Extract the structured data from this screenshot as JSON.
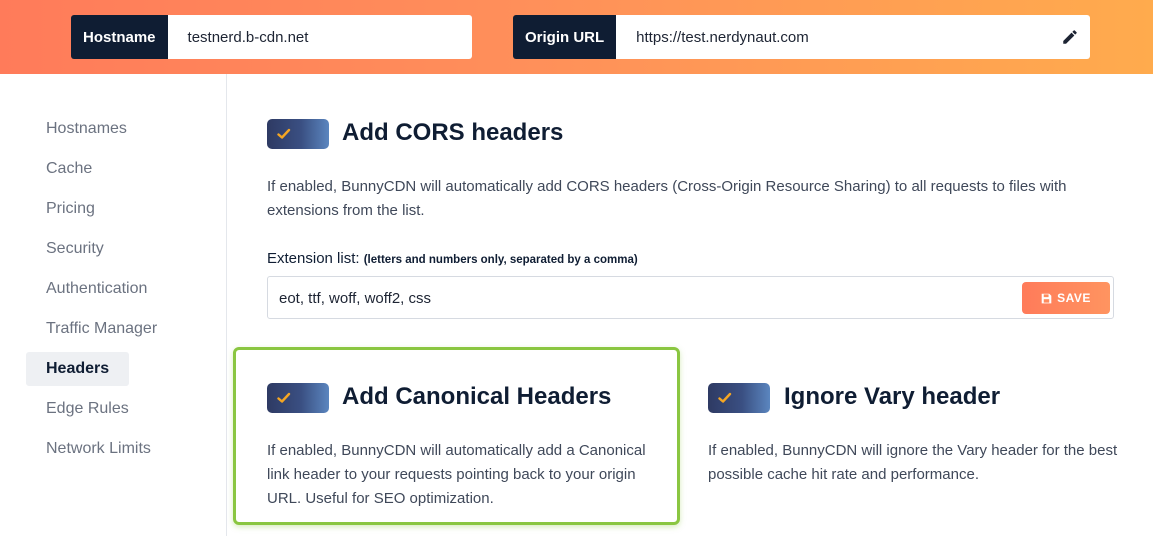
{
  "topbar": {
    "hostname_label": "Hostname",
    "hostname_value": "testnerd.b-cdn.net",
    "origin_label": "Origin URL",
    "origin_value": "https://test.nerdynaut.com",
    "edit_icon": "pencil-icon"
  },
  "sidebar": {
    "items": [
      {
        "label": "Hostnames"
      },
      {
        "label": "Cache"
      },
      {
        "label": "Pricing"
      },
      {
        "label": "Security"
      },
      {
        "label": "Authentication"
      },
      {
        "label": "Traffic Manager"
      },
      {
        "label": "Headers",
        "active": true
      },
      {
        "label": "Edge Rules"
      },
      {
        "label": "Network Limits"
      }
    ]
  },
  "cors": {
    "title": "Add CORS headers",
    "enabled": true,
    "description": "If enabled, BunnyCDN will automatically add CORS headers (Cross-Origin Resource Sharing) to all requests to files with extensions from the list.",
    "extension_label": "Extension list:",
    "extension_hint": "(letters and numbers only, separated by a comma)",
    "extension_value": "eot, ttf, woff, woff2, css",
    "save_label": "SAVE",
    "save_icon": "floppy-disk-icon"
  },
  "canonical": {
    "title": "Add Canonical Headers",
    "enabled": true,
    "description": "If enabled, BunnyCDN will automatically add a Canonical link header to your requests pointing back to your origin URL. Useful for SEO optimization."
  },
  "vary": {
    "title": "Ignore Vary header",
    "enabled": true,
    "description": "If enabled, BunnyCDN will ignore the Vary header for the best possible cache hit rate and performance."
  },
  "colors": {
    "navy": "#0f1d33",
    "accent_orange": "#ff7b5a",
    "check_orange": "#f5a623",
    "highlight_green": "#8ac641"
  }
}
